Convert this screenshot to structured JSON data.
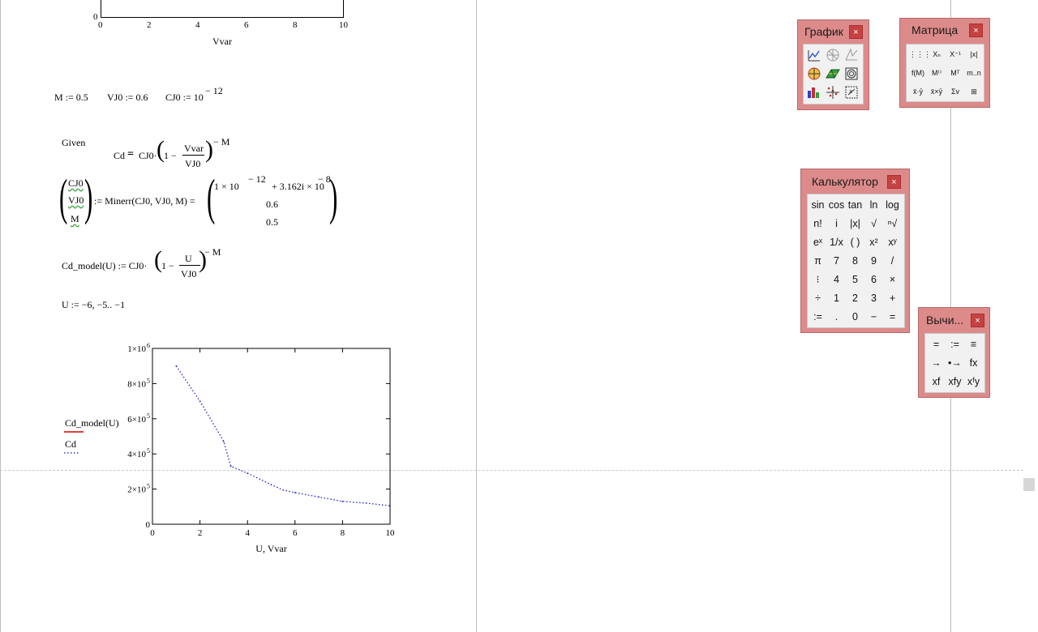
{
  "top_plot": {
    "x_ticks": [
      "0",
      "2",
      "4",
      "6",
      "8",
      "10"
    ],
    "y_tick_zero": "0",
    "xlabel": "Vvar"
  },
  "definitions": {
    "M": "M := 0.5",
    "VJ0": "VJ0 := 0.6",
    "CJ0_lhs": "CJ0 := 10",
    "CJ0_exp": "− 12"
  },
  "given": {
    "label": "Given",
    "lhs": "Cd",
    "eq": "=",
    "rhs_prefix": "CJ0·",
    "one_minus": "1 −",
    "num": "Vvar",
    "den": "VJ0",
    "exp": "− M"
  },
  "minerr": {
    "vars": [
      "CJ0",
      "VJ0",
      "M"
    ],
    "call": ":= Minerr(CJ0, VJ0, M) =",
    "row1_a": "1 × 10",
    "row1_a_exp": "− 12",
    "row1_b": "+ 3.162i × 10",
    "row1_b_exp": "− 8",
    "row2": "0.6",
    "row3": "0.5"
  },
  "cd_model": {
    "lhs": "Cd_model(U) := CJ0·",
    "one_minus": "1 −",
    "num": "U",
    "den": "VJ0",
    "exp": "− M"
  },
  "range_def": "U := −6, −5.. −1",
  "chart_data": {
    "type": "line",
    "x": [
      1,
      2,
      3,
      3.3,
      4,
      5,
      5.5,
      6,
      7,
      8,
      9,
      10
    ],
    "series": [
      {
        "name": "Cd",
        "values": [
          900000,
          700000,
          470000,
          330000,
          290000,
          225000,
          195000,
          180000,
          155000,
          130000,
          120000,
          105000
        ],
        "color": "#1010c0",
        "style": "dotted"
      }
    ],
    "legend_entries": [
      "Cd_model(U)",
      "Cd"
    ],
    "legend_colors": [
      "#d40000",
      "#1010c0"
    ],
    "xlim": [
      0,
      10
    ],
    "ylim": [
      0,
      1000000
    ],
    "x_ticks": [
      "0",
      "2",
      "4",
      "6",
      "8",
      "10"
    ],
    "y_ticks": [
      "0",
      "2×10",
      "4×10",
      "6×10",
      "8×10",
      "1×10"
    ],
    "y_tick_exp": [
      "",
      "5",
      "5",
      "5",
      "5",
      "6"
    ],
    "xlabel": "U, Vvar",
    "grid": false
  },
  "palettes": {
    "graph": {
      "title": "График",
      "close": "×",
      "icons": [
        "xy-plot-icon",
        "polar-plot-icon",
        "surface-plot-icon",
        "contour-plot-icon",
        "3d-bar-plot-icon",
        "3d-scatter-icon",
        "vector-field-icon",
        "bar-plot-icon",
        "zoom-icon"
      ]
    },
    "matrix": {
      "title": "Матрица",
      "close": "×",
      "buttons": [
        "⋮⋮⋮",
        "Xₙ",
        "X⁻¹",
        "|x|",
        "f(M)",
        "M⁽⁾",
        "Mᵀ",
        "m..n",
        "x̄·ȳ",
        "x̄×ȳ",
        "Σv",
        "⊞"
      ]
    },
    "calculator": {
      "title": "Калькулятор",
      "close": "×",
      "buttons": [
        "sin",
        "cos",
        "tan",
        "ln",
        "log",
        "n!",
        "i",
        "|x|",
        "√",
        "ⁿ√",
        "eˣ",
        "1/x",
        "( )",
        "x²",
        "xʸ",
        "π",
        "7",
        "8",
        "9",
        "/",
        "⁝",
        "4",
        "5",
        "6",
        "×",
        "÷",
        "1",
        "2",
        "3",
        "+",
        ":=",
        ".",
        "0",
        "−",
        "="
      ]
    },
    "evaluation": {
      "title": "Вычи...",
      "close": "×",
      "buttons": [
        "=",
        ":=",
        "≡",
        "→",
        "•→",
        "fx",
        "xf",
        "xfy",
        "xᶠy"
      ]
    }
  },
  "colors": {
    "palette_bg": "#dd8a8a",
    "close_bg": "#c64141",
    "trace": "#1010c0",
    "legend_red": "#d40000"
  }
}
